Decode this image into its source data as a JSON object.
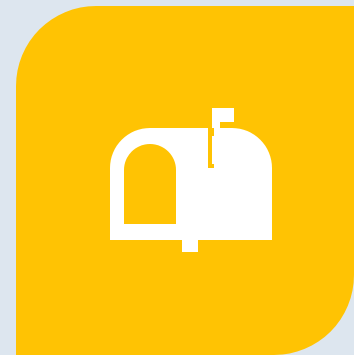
{
  "tile": {
    "icon": "mailbox-icon",
    "background_color": "#ffc303",
    "icon_color": "#ffffff",
    "page_background": "#dde6ef"
  }
}
